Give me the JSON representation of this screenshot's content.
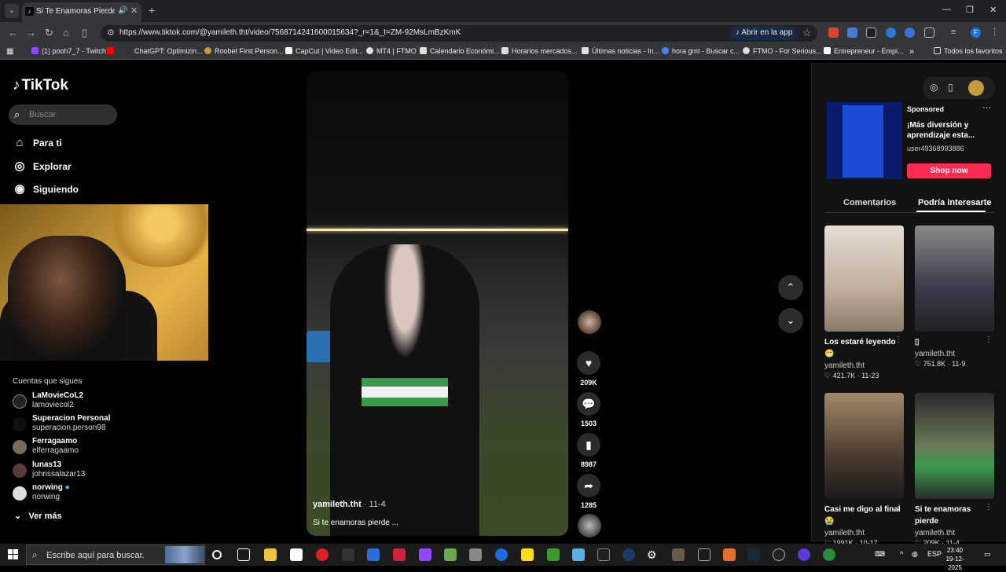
{
  "browser": {
    "tab_title": "Si Te Enamoras Pierdes: Re",
    "url": "https://www.tiktok.com/@yamileth.tht/video/7568714241600015634?_r=1&_t=ZM-92MsLmBzKmK",
    "open_app_label": "Abrir en la app",
    "bookmarks": [
      {
        "label": "(1) pooh7_7 - Twitch",
        "color": "#9146ff"
      },
      {
        "label": "",
        "color": "#ff0000"
      },
      {
        "label": "ChatGPT: Optimizin...",
        "color": "#333333"
      },
      {
        "label": "Roobet First Person...",
        "color": "#c49a3a"
      },
      {
        "label": "CapCut | Video Edit...",
        "color": "#ffffff"
      },
      {
        "label": "MT4 | FTMO",
        "color": "#dddddd"
      },
      {
        "label": "Calendario Económi...",
        "color": "#dddddd"
      },
      {
        "label": "Horarios mercados...",
        "color": "#dddddd"
      },
      {
        "label": "Últimas noticias - In...",
        "color": "#dddddd"
      },
      {
        "label": "hora gmt - Buscar c...",
        "color": "#4285f4"
      },
      {
        "label": "FTMO - For Serious...",
        "color": "#dddddd"
      },
      {
        "label": "Entrepreneur - Empi...",
        "color": "#ffffff"
      }
    ],
    "all_bookmarks": "Todos los favoritos"
  },
  "sidebar": {
    "logo": "TikTok",
    "search_placeholder": "Buscar",
    "nav": [
      {
        "label": "Para ti",
        "icon": "home-icon"
      },
      {
        "label": "Explorar",
        "icon": "compass-icon"
      },
      {
        "label": "Siguiendo",
        "icon": "following-avatar-icon"
      }
    ],
    "following_heading": "Cuentas que sigues",
    "following": [
      {
        "name": "LaMovieCoL2",
        "user": "lamoviecol2"
      },
      {
        "name": "Superacion Personal",
        "user": "superacion.person98"
      },
      {
        "name": "Ferragaamo",
        "user": "elferragaamo"
      },
      {
        "name": "lunas13",
        "user": "johnssalazar13"
      },
      {
        "name": "norwing",
        "user": "norwing"
      }
    ],
    "see_more": "Ver más"
  },
  "video": {
    "author": "yamileth.tht",
    "date": "· 11-4",
    "description": "Si te enamoras pierde ...",
    "likes": "209K",
    "comments": "1503",
    "saves": "8987",
    "shares": "1285"
  },
  "ad": {
    "sponsored": "Sponsored",
    "title": "¡Más diversión y aprendizaje esta...",
    "user": "user49368993886",
    "cta": "Shop now"
  },
  "right_tabs": {
    "comments": "Comentarios",
    "suggested": "Podría interesarte"
  },
  "cards": [
    {
      "title": "Los estaré leyendo 😁",
      "user": "yamileth.tht",
      "stats": "♡ 421.7K · 11-23",
      "color": "#d8cfc5"
    },
    {
      "title": "▯",
      "user": "yamileth.tht",
      "stats": "♡ 751.8K · 11-9",
      "color": "#3a3a4a"
    },
    {
      "title": "Casi me digo al final 😭",
      "user": "yamileth.tht",
      "stats": "♡ 1991K · 10-17",
      "color": "#5a4a40"
    },
    {
      "title": "Si te enamoras pierde",
      "user": "yamileth.tht",
      "stats": "♡ 209K · 11-4",
      "color": "#8a9a7a"
    }
  ],
  "taskbar": {
    "search_placeholder": "Escribe aquí para buscar.",
    "lang": "ESP",
    "time": "23:40",
    "date": "19-12-2025"
  }
}
